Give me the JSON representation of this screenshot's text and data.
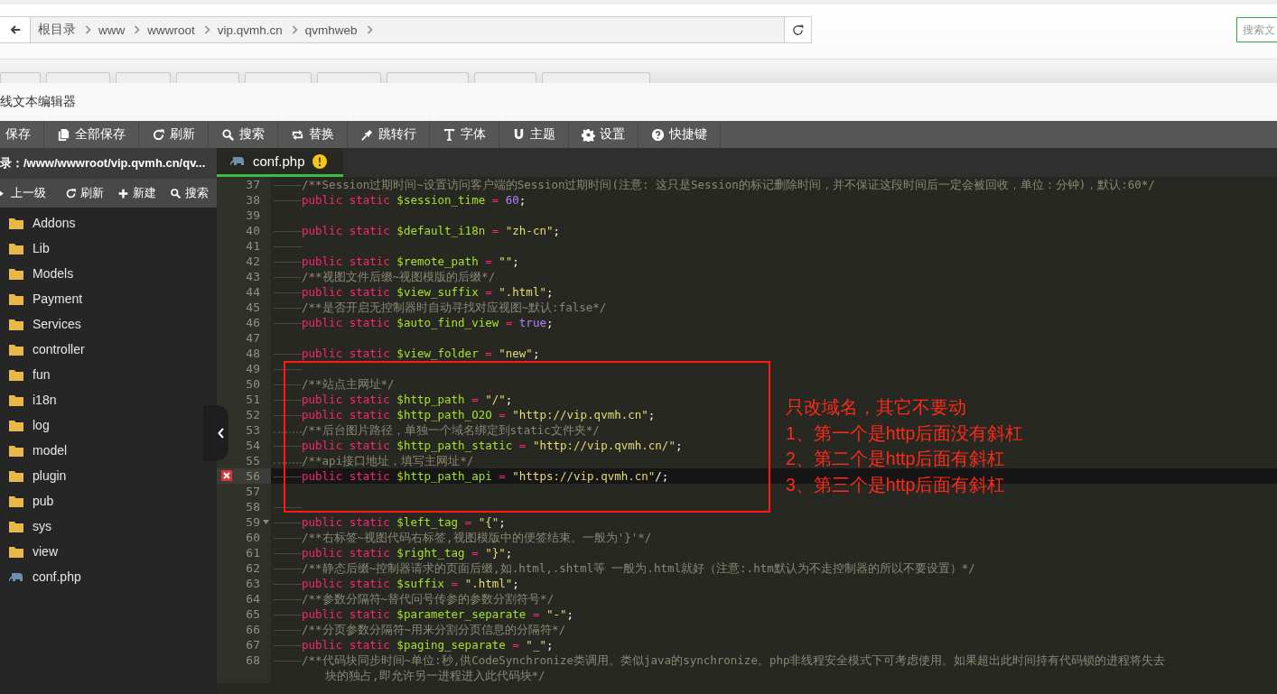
{
  "breadcrumb": {
    "items": [
      "根目录",
      "www",
      "wwwroot",
      "vip.qvmh.cn",
      "qvmhweb"
    ]
  },
  "search": {
    "placeholder": "搜索文"
  },
  "dialog": {
    "title": "线文本编辑器"
  },
  "toolbar": [
    "保存",
    "全部保存",
    "刷新",
    "搜索",
    "替换",
    "跳转行",
    "字体",
    "主题",
    "设置",
    "快捷键"
  ],
  "sidebar": {
    "path": "录：/www/wwwroot/vip.qvmh.cn/qv...",
    "actions": [
      "上一级",
      "刷新",
      "新建",
      "搜索"
    ],
    "files": [
      {
        "name": "Addons",
        "kind": "folder"
      },
      {
        "name": "Lib",
        "kind": "folder"
      },
      {
        "name": "Models",
        "kind": "folder"
      },
      {
        "name": "Payment",
        "kind": "folder"
      },
      {
        "name": "Services",
        "kind": "folder"
      },
      {
        "name": "controller",
        "kind": "folder"
      },
      {
        "name": "fun",
        "kind": "folder"
      },
      {
        "name": "i18n",
        "kind": "folder"
      },
      {
        "name": "log",
        "kind": "folder"
      },
      {
        "name": "model",
        "kind": "folder"
      },
      {
        "name": "plugin",
        "kind": "folder"
      },
      {
        "name": "pub",
        "kind": "folder"
      },
      {
        "name": "sys",
        "kind": "folder"
      },
      {
        "name": "view",
        "kind": "folder"
      },
      {
        "name": "conf.php",
        "kind": "php"
      }
    ]
  },
  "tabs": [
    {
      "label": "conf.php",
      "selected": true,
      "warning": true
    }
  ],
  "code": [
    {
      "n": "37",
      "kind": "tab",
      "active": false,
      "error": false,
      "fold": false,
      "t": [
        {
          "kind": "c",
          "text": "/**Session过期时间~设置访问客户端的Session过期时间(注意: 这只是Session的标记删除时间，并不保证这段时间后一定会被回收，单位：分钟)，默认:60*/"
        }
      ]
    },
    {
      "n": "38",
      "kind": "tab",
      "active": false,
      "error": false,
      "fold": false,
      "t": [
        {
          "kind": "k",
          "text": "public static "
        },
        {
          "kind": "v",
          "text": "$session_time"
        },
        {
          "kind": "o",
          "text": " = "
        },
        {
          "kind": "n",
          "text": "60"
        },
        {
          "kind": "p",
          "text": ";"
        }
      ]
    },
    {
      "n": "39",
      "kind": "blank",
      "active": false,
      "error": false,
      "fold": false
    },
    {
      "n": "40",
      "kind": "tab",
      "active": false,
      "error": false,
      "fold": false,
      "t": [
        {
          "kind": "k",
          "text": "public static "
        },
        {
          "kind": "v",
          "text": "$default_i18n"
        },
        {
          "kind": "o",
          "text": " = "
        },
        {
          "kind": "s",
          "text": "\"zh-cn\""
        },
        {
          "kind": "p",
          "text": ";"
        }
      ]
    },
    {
      "n": "41",
      "kind": "tab",
      "active": false,
      "error": false,
      "fold": false
    },
    {
      "n": "42",
      "kind": "tab",
      "active": false,
      "error": false,
      "fold": false,
      "t": [
        {
          "kind": "k",
          "text": "public static "
        },
        {
          "kind": "v",
          "text": "$remote_path"
        },
        {
          "kind": "o",
          "text": " = "
        },
        {
          "kind": "s",
          "text": "\"\""
        },
        {
          "kind": "p",
          "text": ";"
        }
      ]
    },
    {
      "n": "43",
      "kind": "tab",
      "active": false,
      "error": false,
      "fold": false,
      "t": [
        {
          "kind": "c",
          "text": "/**视图文件后缀~视图模版的后缀*/"
        }
      ]
    },
    {
      "n": "44",
      "kind": "tab",
      "active": false,
      "error": false,
      "fold": false,
      "t": [
        {
          "kind": "k",
          "text": "public static "
        },
        {
          "kind": "v",
          "text": "$view_suffix"
        },
        {
          "kind": "o",
          "text": " = "
        },
        {
          "kind": "s",
          "text": "\".html\""
        },
        {
          "kind": "p",
          "text": ";"
        }
      ]
    },
    {
      "n": "45",
      "kind": "tab",
      "active": false,
      "error": false,
      "fold": false,
      "t": [
        {
          "kind": "c",
          "text": "/**是否开启无控制器时自动寻找对应视图~默认:false*/"
        }
      ]
    },
    {
      "n": "46",
      "kind": "tab",
      "active": false,
      "error": false,
      "fold": false,
      "t": [
        {
          "kind": "k",
          "text": "public static "
        },
        {
          "kind": "v",
          "text": "$auto_find_view"
        },
        {
          "kind": "o",
          "text": " = "
        },
        {
          "kind": "b",
          "text": "true"
        },
        {
          "kind": "p",
          "text": ";"
        }
      ]
    },
    {
      "n": "47",
      "kind": "blank",
      "active": false,
      "error": false,
      "fold": false
    },
    {
      "n": "48",
      "kind": "tab",
      "active": false,
      "error": false,
      "fold": false,
      "t": [
        {
          "kind": "k",
          "text": "public static "
        },
        {
          "kind": "v",
          "text": "$view_folder"
        },
        {
          "kind": "o",
          "text": " = "
        },
        {
          "kind": "s",
          "text": "\"new\""
        },
        {
          "kind": "p",
          "text": ";"
        }
      ]
    },
    {
      "n": "49",
      "kind": "tab",
      "active": false,
      "error": false,
      "fold": false
    },
    {
      "n": "50",
      "kind": "tab",
      "active": false,
      "error": false,
      "fold": false,
      "t": [
        {
          "kind": "c",
          "text": "/**站点主网址*/"
        }
      ]
    },
    {
      "n": "51",
      "kind": "tab",
      "active": false,
      "error": false,
      "fold": false,
      "t": [
        {
          "kind": "k",
          "text": "public static "
        },
        {
          "kind": "v",
          "text": "$http_path"
        },
        {
          "kind": "o",
          "text": " = "
        },
        {
          "kind": "s",
          "text": "\"/\""
        },
        {
          "kind": "p",
          "text": ";"
        }
      ]
    },
    {
      "n": "52",
      "kind": "tab",
      "active": false,
      "error": false,
      "fold": false,
      "t": [
        {
          "kind": "k",
          "text": "public static "
        },
        {
          "kind": "v",
          "text": "$http_path_O2O"
        },
        {
          "kind": "o",
          "text": " = "
        },
        {
          "kind": "s",
          "text": "\"http://vip.qvmh.cn\""
        },
        {
          "kind": "p",
          "text": ";"
        }
      ]
    },
    {
      "n": "53",
      "kind": "dots",
      "active": false,
      "error": false,
      "fold": false,
      "t": [
        {
          "kind": "c",
          "text": "/**后台图片路径，单独一个域名绑定到static文件夹*/"
        }
      ]
    },
    {
      "n": "54",
      "kind": "tab",
      "active": false,
      "error": false,
      "fold": false,
      "t": [
        {
          "kind": "k",
          "text": "public static "
        },
        {
          "kind": "v",
          "text": "$http_path_static"
        },
        {
          "kind": "o",
          "text": " = "
        },
        {
          "kind": "s",
          "text": "\"http://vip.qvmh.cn/\""
        },
        {
          "kind": "p",
          "text": ";"
        }
      ]
    },
    {
      "n": "55",
      "kind": "dots",
      "active": false,
      "error": false,
      "fold": false,
      "t": [
        {
          "kind": "c",
          "text": "/**api接口地址，填写主网址*/"
        }
      ]
    },
    {
      "n": "56",
      "kind": "tab",
      "active": true,
      "error": true,
      "fold": false,
      "t": [
        {
          "kind": "k",
          "text": "public static "
        },
        {
          "kind": "v",
          "text": "$http_path_api"
        },
        {
          "kind": "o",
          "text": " = "
        },
        {
          "kind": "s",
          "text": "\"https://vip.qvmh.cn\""
        },
        {
          "kind": "p",
          "text": "/;"
        }
      ]
    },
    {
      "n": "57",
      "kind": "blank",
      "active": false,
      "error": false,
      "fold": false
    },
    {
      "n": "58",
      "kind": "tab",
      "active": false,
      "error": false,
      "fold": false
    },
    {
      "n": "59",
      "kind": "tab",
      "active": false,
      "error": false,
      "fold": true,
      "t": [
        {
          "kind": "k",
          "text": "public static "
        },
        {
          "kind": "v",
          "text": "$left_tag"
        },
        {
          "kind": "o",
          "text": " = "
        },
        {
          "kind": "s",
          "text": "\"{\""
        },
        {
          "kind": "p",
          "text": ";"
        }
      ]
    },
    {
      "n": "60",
      "kind": "tab",
      "active": false,
      "error": false,
      "fold": false,
      "t": [
        {
          "kind": "c",
          "text": "/**右标签~视图代码右标签,视图模版中的便签结束。一般为'}'*/"
        }
      ]
    },
    {
      "n": "61",
      "kind": "tab",
      "active": false,
      "error": false,
      "fold": false,
      "t": [
        {
          "kind": "k",
          "text": "public static "
        },
        {
          "kind": "v",
          "text": "$right_tag"
        },
        {
          "kind": "o",
          "text": " = "
        },
        {
          "kind": "s",
          "text": "\"}\""
        },
        {
          "kind": "p",
          "text": ";"
        }
      ]
    },
    {
      "n": "62",
      "kind": "tab",
      "active": false,
      "error": false,
      "fold": false,
      "t": [
        {
          "kind": "c",
          "text": "/**静态后缀~控制器请求的页面后缀,如.html,.shtml等 一般为.html就好（注意:.htm默认为不走控制器的所以不要设置）*/"
        }
      ]
    },
    {
      "n": "63",
      "kind": "tab",
      "active": false,
      "error": false,
      "fold": false,
      "t": [
        {
          "kind": "k",
          "text": "public static "
        },
        {
          "kind": "v",
          "text": "$suffix"
        },
        {
          "kind": "o",
          "text": " = "
        },
        {
          "kind": "s",
          "text": "\".html\""
        },
        {
          "kind": "p",
          "text": ";"
        }
      ]
    },
    {
      "n": "64",
      "kind": "tab",
      "active": false,
      "error": false,
      "fold": false,
      "t": [
        {
          "kind": "c",
          "text": "/**参数分隔符~替代问号传参的参数分割符号*/"
        }
      ]
    },
    {
      "n": "65",
      "kind": "tab",
      "active": false,
      "error": false,
      "fold": false,
      "t": [
        {
          "kind": "k",
          "text": "public static "
        },
        {
          "kind": "v",
          "text": "$parameter_separate"
        },
        {
          "kind": "o",
          "text": " = "
        },
        {
          "kind": "s",
          "text": "\"-\""
        },
        {
          "kind": "p",
          "text": ";"
        }
      ]
    },
    {
      "n": "66",
      "kind": "tab",
      "active": false,
      "error": false,
      "fold": false,
      "t": [
        {
          "kind": "c",
          "text": "/**分页参数分隔符~用来分割分页信息的分隔符*/"
        }
      ]
    },
    {
      "n": "67",
      "kind": "tab",
      "active": false,
      "error": false,
      "fold": false,
      "t": [
        {
          "kind": "k",
          "text": "public static "
        },
        {
          "kind": "v",
          "text": "$paging_separate"
        },
        {
          "kind": "o",
          "text": " = "
        },
        {
          "kind": "s",
          "text": "\"_\""
        },
        {
          "kind": "p",
          "text": ";"
        }
      ]
    },
    {
      "n": "68",
      "kind": "tab",
      "active": false,
      "error": false,
      "fold": false,
      "t": [
        {
          "kind": "c",
          "text": "/**代码块同步时间~单位:秒,供CodeSynchronize类调用。类似java的synchronize。php非线程安全模式下可考虑使用。如果超出此时间持有代码锁的进程将失去"
        }
      ],
      "wrap": "块的独占,即允许另一进程进入此代码块*/"
    }
  ],
  "annotation": {
    "lines": [
      "只改域名，其它不要动",
      "1、第一个是http后面没有斜杠",
      "2、第二个是http后面有斜杠",
      "3、第三个是http后面有斜杠"
    ]
  }
}
